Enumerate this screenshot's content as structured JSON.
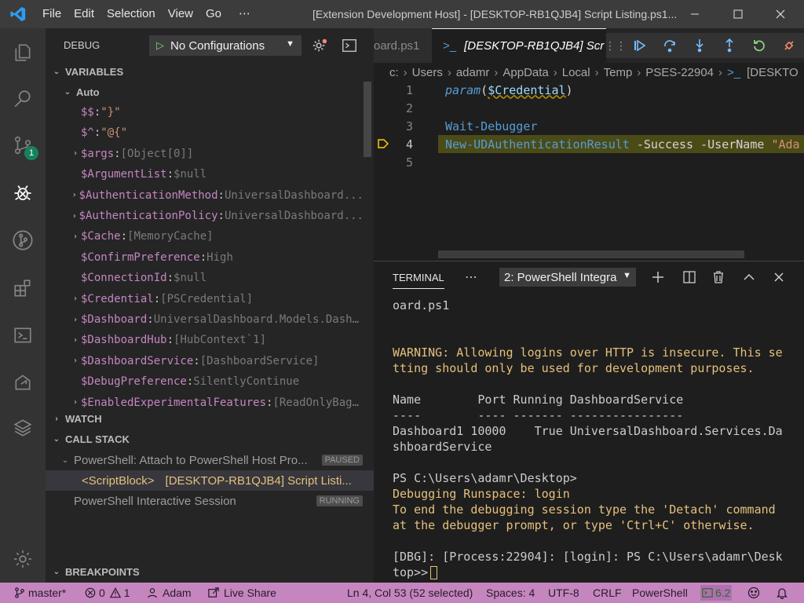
{
  "titlebar": {
    "menu": [
      "File",
      "Edit",
      "Selection",
      "View",
      "Go",
      "⋯"
    ],
    "title": "[Extension Development Host] - [DESKTOP-RB1QJB4] Script Listing.ps1...",
    "min_icon": "minimize-icon",
    "max_icon": "maximize-icon",
    "close_icon": "close-icon"
  },
  "activitybar": {
    "icons": [
      "explorer-icon",
      "search-icon",
      "source-control-icon",
      "debug-icon",
      "git-graph-icon",
      "extensions-icon",
      "powershell-icon",
      "remote-explorer-icon",
      "layers-icon",
      "settings-gear-icon"
    ],
    "scm_badge": "1"
  },
  "debug": {
    "title": "DEBUG",
    "config": "No Configurations"
  },
  "variables": {
    "header": "VARIABLES",
    "scope": "Auto",
    "items": [
      {
        "name": "$$",
        "value": "\"}\"",
        "kind": "str",
        "expandable": false
      },
      {
        "name": "$^",
        "value": "\"@{\"",
        "kind": "str",
        "expandable": false
      },
      {
        "name": "$args",
        "value": "[Object[0]]",
        "kind": "gray",
        "expandable": true
      },
      {
        "name": "$ArgumentList",
        "value": "$null",
        "kind": "gray",
        "expandable": false
      },
      {
        "name": "$AuthenticationMethod",
        "value": "UniversalDashboard...",
        "kind": "gray",
        "expandable": true
      },
      {
        "name": "$AuthenticationPolicy",
        "value": "UniversalDashboard...",
        "kind": "gray",
        "expandable": true
      },
      {
        "name": "$Cache",
        "value": "[MemoryCache]",
        "kind": "gray",
        "expandable": true
      },
      {
        "name": "$ConfirmPreference",
        "value": "High",
        "kind": "gray",
        "expandable": false
      },
      {
        "name": "$ConnectionId",
        "value": "$null",
        "kind": "gray",
        "expandable": false
      },
      {
        "name": "$Credential",
        "value": "[PSCredential]",
        "kind": "gray",
        "expandable": true
      },
      {
        "name": "$Dashboard",
        "value": "UniversalDashboard.Models.Dash…",
        "kind": "gray",
        "expandable": true
      },
      {
        "name": "$DashboardHub",
        "value": "[HubContext`1]",
        "kind": "gray",
        "expandable": true
      },
      {
        "name": "$DashboardService",
        "value": "[DashboardService]",
        "kind": "gray",
        "expandable": true
      },
      {
        "name": "$DebugPreference",
        "value": "SilentlyContinue",
        "kind": "gray",
        "expandable": false
      },
      {
        "name": "$EnabledExperimentalFeatures",
        "value": "[ReadOnlyBag…",
        "kind": "gray",
        "expandable": true
      }
    ]
  },
  "watch": {
    "header": "WATCH"
  },
  "callstack": {
    "header": "CALL STACK",
    "session1": "PowerShell: Attach to PowerShell Host Pro...",
    "session1_state": "PAUSED",
    "frame_name": "<ScriptBlock>",
    "frame_file": "[DESKTOP-RB1QJB4] Script Listi...",
    "session2": "PowerShell Interactive Session",
    "session2_state": "RUNNING"
  },
  "breakpoints": {
    "header": "BREAKPOINTS"
  },
  "editor": {
    "tab_inactive": "oard.ps1",
    "tab_active": "[DESKTOP-RB1QJB4] Scr",
    "breadcrumb": [
      "c:",
      "Users",
      "adamr",
      "AppData",
      "Local",
      "Temp",
      "PSES-22904",
      "[DESKTO"
    ],
    "lines": [
      "1",
      "2",
      "3",
      "4",
      "5"
    ],
    "code": {
      "l1_kw": "param",
      "l1_paren_open": "(",
      "l1_var": "$Credential",
      "l1_paren_close": ")",
      "l3_cmd": "Wait-Debugger",
      "l4_cmd": "New-UDAuthenticationResult",
      "l4_p1": "-Success",
      "l4_p2": "-UserName",
      "l4_str": "\"Ada"
    }
  },
  "panel": {
    "title": "TERMINAL",
    "terminal_select": "2: PowerShell Integra",
    "lines": [
      {
        "text": "oard.ps1",
        "kind": "plain"
      },
      {
        "text": "",
        "kind": "plain"
      },
      {
        "text": "",
        "kind": "plain"
      },
      {
        "text": "WARNING: Allowing logins over HTTP is insecure. This se",
        "kind": "warn"
      },
      {
        "text": "tting should only be used for development purposes.",
        "kind": "warn"
      },
      {
        "text": "",
        "kind": "plain"
      },
      {
        "text": "Name        Port Running DashboardService",
        "kind": "plain"
      },
      {
        "text": "----        ---- ------- ----------------",
        "kind": "plain"
      },
      {
        "text": "Dashboard1 10000    True UniversalDashboard.Services.Da",
        "kind": "plain"
      },
      {
        "text": "shboardService",
        "kind": "plain"
      },
      {
        "text": "",
        "kind": "plain"
      },
      {
        "text": "PS C:\\Users\\adamr\\Desktop>",
        "kind": "plain"
      },
      {
        "text": "Debugging Runspace: login",
        "kind": "warn"
      },
      {
        "text": "To end the debugging session type the 'Detach' command",
        "kind": "warn"
      },
      {
        "text": "at the debugger prompt, or type 'Ctrl+C' otherwise.",
        "kind": "warn"
      },
      {
        "text": "",
        "kind": "plain"
      },
      {
        "text": "[DBG]: [Process:22904]: [login]: PS C:\\Users\\adamr\\Desk",
        "kind": "plain"
      },
      {
        "text": "top>>",
        "kind": "plain"
      }
    ]
  },
  "statusbar": {
    "branch": "master*",
    "errors": "0",
    "warnings": "1",
    "user": "Adam",
    "liveshare": "Live Share",
    "position": "Ln 4, Col 53 (52 selected)",
    "spaces": "Spaces: 4",
    "encoding": "UTF-8",
    "eol": "CRLF",
    "language": "PowerShell",
    "ps_version": "6.2"
  }
}
